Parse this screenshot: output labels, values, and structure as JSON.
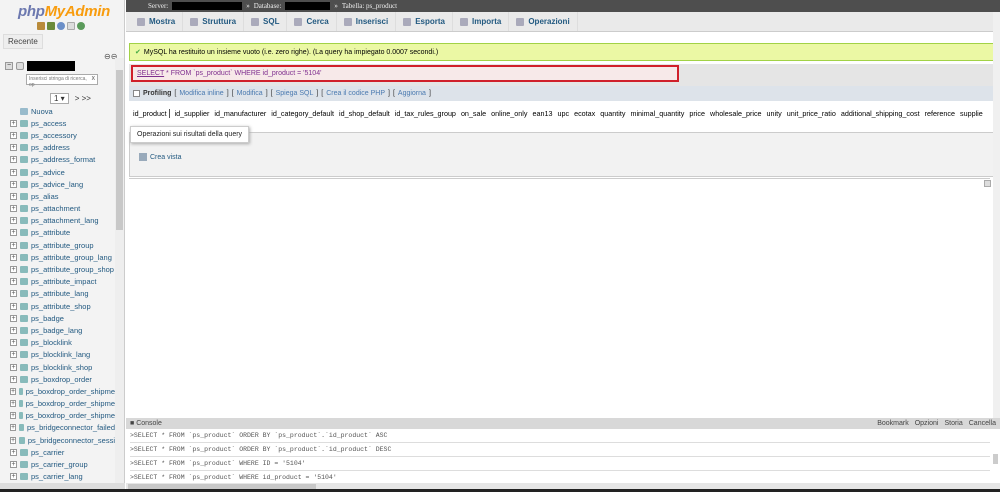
{
  "sidebar": {
    "logo_php": "php",
    "logo_myadmin": "MyAdmin",
    "recent_label": "Recente",
    "search_placeholder": "Inserisci stringa di ricerca, op",
    "search_clear": "X",
    "page_select": "1 ▾",
    "page_next": "> >>",
    "new_label": "Nuova",
    "tables": [
      "ps_access",
      "ps_accessory",
      "ps_address",
      "ps_address_format",
      "ps_advice",
      "ps_advice_lang",
      "ps_alias",
      "ps_attachment",
      "ps_attachment_lang",
      "ps_attribute",
      "ps_attribute_group",
      "ps_attribute_group_lang",
      "ps_attribute_group_shop",
      "ps_attribute_impact",
      "ps_attribute_lang",
      "ps_attribute_shop",
      "ps_badge",
      "ps_badge_lang",
      "ps_blocklink",
      "ps_blocklink_lang",
      "ps_blocklink_shop",
      "ps_boxdrop_order",
      "ps_boxdrop_order_shipme",
      "ps_boxdrop_order_shipme",
      "ps_boxdrop_order_shipme",
      "ps_bridgeconnector_failed",
      "ps_bridgeconnector_sessi",
      "ps_carrier",
      "ps_carrier_group",
      "ps_carrier_lang"
    ]
  },
  "breadcrumb": {
    "server_label": "Server:",
    "database_label": "Database:",
    "table_label": "Tabella: ps_product"
  },
  "tabs": [
    "Mostra",
    "Struttura",
    "SQL",
    "Cerca",
    "Inserisci",
    "Esporta",
    "Importa",
    "Operazioni"
  ],
  "message": "MySQL ha restituito un insieme vuoto (i.e. zero righe). (La query ha impiegato 0.0007 secondi.)",
  "query": {
    "keyword": "SELECT",
    "rest": " * FROM `ps_product` WHERE id_product = '5104'"
  },
  "profiling": {
    "label": "Profiling",
    "links": [
      "Modifica inline",
      "Modifica",
      "Spiega SQL",
      "Crea il codice PHP",
      "Aggiorna"
    ]
  },
  "columns": [
    "id_product",
    "id_supplier",
    "id_manufacturer",
    "id_category_default",
    "id_shop_default",
    "id_tax_rules_group",
    "on_sale",
    "online_only",
    "ean13",
    "upc",
    "ecotax",
    "quantity",
    "minimal_quantity",
    "price",
    "wholesale_price",
    "unity",
    "unit_price_ratio",
    "additional_shipping_cost",
    "reference",
    "supplie"
  ],
  "operations": {
    "title": "Operazioni sui risultati della query",
    "create_view": "Crea vista"
  },
  "console": {
    "title": "Console",
    "actions": [
      "Bookmark",
      "Opzioni",
      "Storia",
      "Cancella"
    ],
    "entries": [
      ">SELECT * FROM `ps_product` ORDER BY `ps_product`.`id_product` ASC",
      ">SELECT * FROM `ps_product` ORDER BY `ps_product`.`id_product` DESC",
      ">SELECT * FROM `ps_product` WHERE ID = '5104'",
      ">SELECT * FROM `ps_product` WHERE id_product = '5104'"
    ]
  }
}
